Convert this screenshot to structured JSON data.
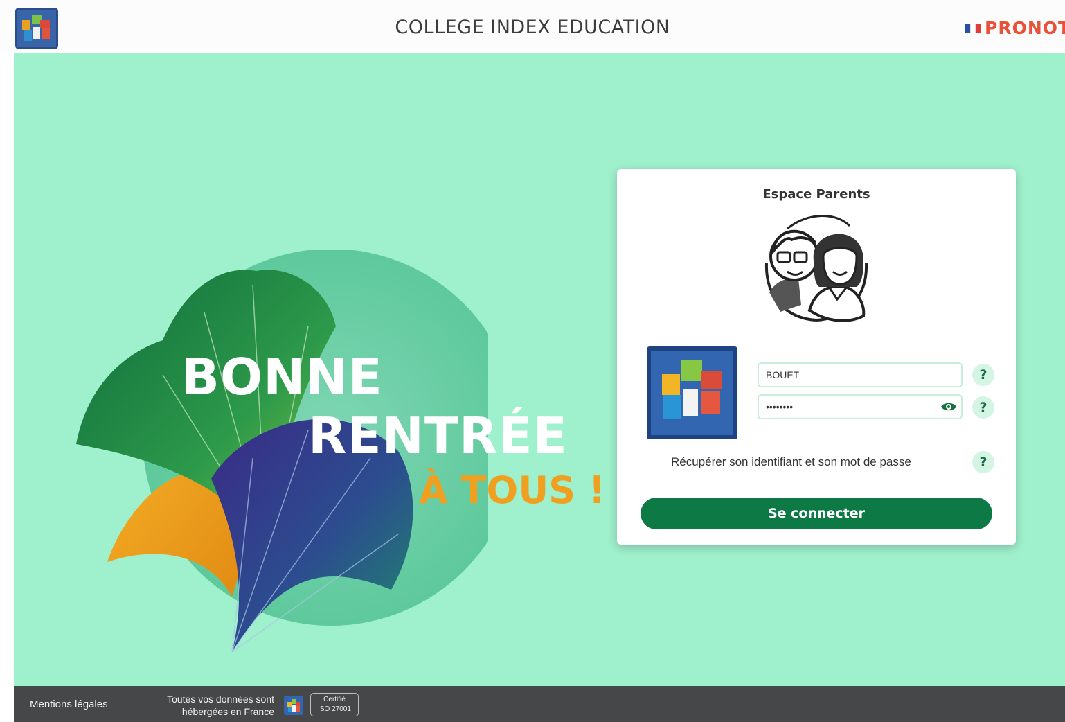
{
  "header": {
    "title": "COLLEGE INDEX EDUCATION",
    "brand": "PRONOTE",
    "flag_colors": [
      "#2a4fa0",
      "#ffffff",
      "#e23b3b"
    ]
  },
  "hero": {
    "line1": "BONNE",
    "line2": "RENTRÉE",
    "line3": "À TOUS !"
  },
  "login": {
    "title": "Espace Parents",
    "username_value": "BOUET",
    "password_value": "••••••••",
    "help_label": "?",
    "recover_text": "Récupérer son identifiant et son mot de passe",
    "submit_label": "Se connecter"
  },
  "footer": {
    "legal": "Mentions légales",
    "hosted_line1": "Toutes vos données sont",
    "hosted_line2": "hébergées en France",
    "cert_line1": "Certifié",
    "cert_line2": "ISO 27001"
  },
  "colors": {
    "background": "#9ff0cc",
    "primary_button": "#0d7a46",
    "hero_accent": "#f0a020",
    "footer": "#464748"
  },
  "icons": [
    "app-logo-icon",
    "parents-illustration-icon",
    "school-logo-icon",
    "eye-icon",
    "help-icon",
    "footer-logo-icon"
  ]
}
